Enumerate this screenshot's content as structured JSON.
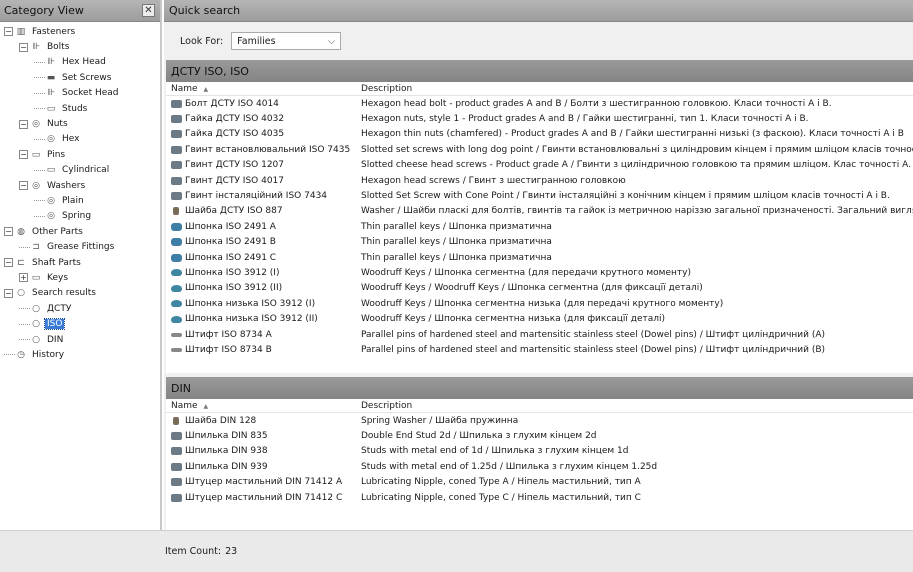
{
  "category_panel": {
    "title": "Category View",
    "close_glyph": "✕",
    "tree": [
      {
        "label": "Fasteners",
        "level": 0,
        "expander": "−",
        "icon": "folder-icon"
      },
      {
        "label": "Bolts",
        "level": 1,
        "expander": "−",
        "icon": "bolt-icon"
      },
      {
        "label": "Hex Head",
        "level": 2,
        "icon": "hex-head-icon"
      },
      {
        "label": "Set Screws",
        "level": 2,
        "icon": "set-screw-icon"
      },
      {
        "label": "Socket Head",
        "level": 2,
        "icon": "socket-head-icon"
      },
      {
        "label": "Studs",
        "level": 2,
        "icon": "stud-icon"
      },
      {
        "label": "Nuts",
        "level": 1,
        "expander": "−",
        "icon": "nut-icon"
      },
      {
        "label": "Hex",
        "level": 2,
        "icon": "hex-nut-icon"
      },
      {
        "label": "Pins",
        "level": 1,
        "expander": "−",
        "icon": "pin-icon"
      },
      {
        "label": "Cylindrical",
        "level": 2,
        "icon": "cylindrical-pin-icon"
      },
      {
        "label": "Washers",
        "level": 1,
        "expander": "−",
        "icon": "washer-icon"
      },
      {
        "label": "Plain",
        "level": 2,
        "icon": "plain-washer-icon"
      },
      {
        "label": "Spring",
        "level": 2,
        "icon": "spring-washer-icon"
      },
      {
        "label": "Other Parts",
        "level": 0,
        "expander": "−",
        "icon": "other-parts-icon"
      },
      {
        "label": "Grease Fittings",
        "level": 1,
        "icon": "grease-fitting-icon"
      },
      {
        "label": "Shaft Parts",
        "level": 0,
        "expander": "−",
        "icon": "shaft-icon"
      },
      {
        "label": "Keys",
        "level": 1,
        "expander": "+",
        "icon": "key-icon"
      },
      {
        "label": "Search results",
        "level": 0,
        "expander": "−",
        "icon": "search-icon"
      },
      {
        "label": "ДСТУ",
        "level": 1,
        "icon": "search-icon"
      },
      {
        "label": "ISO",
        "level": 1,
        "icon": "search-icon",
        "selected": true
      },
      {
        "label": "DIN",
        "level": 1,
        "icon": "search-icon"
      },
      {
        "label": "History",
        "level": 0,
        "icon": "history-icon"
      }
    ]
  },
  "quick_search": {
    "title": "Quick search",
    "look_for_label": "Look For:",
    "look_for_value": "Families",
    "dropdown_glyph": "⌵"
  },
  "sections": [
    {
      "title": "ДСТУ ISO, ISO",
      "col_name": "Name",
      "col_desc": "Description",
      "sort_glyph": "▲",
      "rows": [
        {
          "name": "Болт ДСТУ ISO 4014",
          "desc": "Hexagon head bolt - product grades A and B / Болти з шестигранною головкою. Класи точності А і В.",
          "icon": "bolt-icon"
        },
        {
          "name": "Гайка ДСТУ ISO 4032",
          "desc": "Hexagon nuts, style 1 - Product grades A and B / Гайки шестигранні, тип 1. Класи точності А і В.",
          "icon": "nut-icon"
        },
        {
          "name": "Гайка ДСТУ ISO 4035",
          "desc": "Hexagon thin nuts (chamfered) - Product grades A and B / Гайки шестигранні низькі (з фаскою). Класи точності А і В",
          "icon": "nut-icon"
        },
        {
          "name": "Гвинт встановлювальний ISO 7435",
          "desc": "Slotted set screws with long dog point / Гвинти встановлювальні з циліндровим кінцем і прямим шліцом класів точності А і.",
          "icon": "set-screw-icon"
        },
        {
          "name": "Гвинт ДСТУ ISO 1207",
          "desc": "Slotted cheese head screws - Product grade A / Ґвинти з циліндричною головкою та прямим шліцом. Клас точності А.",
          "icon": "screw-icon"
        },
        {
          "name": "Гвинт ДСТУ ISO 4017",
          "desc": "Hexagon head screws / Гвинт з  шестигранною головкою",
          "icon": "screw-icon"
        },
        {
          "name": "Гвинт інсталяційний ISO 7434",
          "desc": "Slotted Set Screw with Cone Point / Гвинти інсталяційні з конічним кінцем і прямим шліцом класів точності А і В.",
          "icon": "set-screw-icon"
        },
        {
          "name": "Шайба ДСТУ ISO 887",
          "desc": "Washer / Шайби пласкі для болтів, гвинтів та гайок із метричною наріззю загальної призначеності. Загальний вигляд",
          "icon": "washer-icon"
        },
        {
          "name": "Шпонка ISO 2491 A",
          "desc": "Thin parallel keys / Шпонка призматична",
          "icon": "key-icon"
        },
        {
          "name": "Шпонка ISO 2491 B",
          "desc": "Thin parallel keys / Шпонка призматична",
          "icon": "key-icon"
        },
        {
          "name": "Шпонка ISO 2491 C",
          "desc": "Thin parallel keys / Шпонка призматична",
          "icon": "key-icon"
        },
        {
          "name": "Шпонка ISO 3912 (I)",
          "desc": "Woodruff Keys / Шпонка сегментна (для передачи крутного моменту)",
          "icon": "woodruff-key-icon"
        },
        {
          "name": "Шпонка ISO 3912 (II)",
          "desc": "Woodruff Keys / Woodruff Keys / Шпонка сегментна (для фиксацїї деталі)",
          "icon": "woodruff-key-icon"
        },
        {
          "name": "Шпонка низька ISO 3912 (I)",
          "desc": "Woodruff Keys / Шпонка сегментна низька (для передачі крутного моменту)",
          "icon": "woodruff-key-icon"
        },
        {
          "name": "Шпонка низька ISO 3912 (II)",
          "desc": "Woodruff Keys / Шпонка сегментна низька (для фиксацїї деталі)",
          "icon": "woodruff-key-icon"
        },
        {
          "name": "Штифт ISO 8734 A",
          "desc": "Parallel pins of hardened steel and martensitic stainless steel (Dowel pins) / Штифт циліндричний (А)",
          "icon": "pin-icon"
        },
        {
          "name": "Штифт ISO 8734 B",
          "desc": "Parallel pins of hardened steel and martensitic stainless steel (Dowel pins) / Штифт циліндричний (В)",
          "icon": "pin-icon"
        }
      ]
    },
    {
      "title": "DIN",
      "col_name": "Name",
      "col_desc": "Description",
      "sort_glyph": "▲",
      "rows": [
        {
          "name": "Шайба DIN 128",
          "desc": "Spring Washer / Шайба пружинна",
          "icon": "washer-icon"
        },
        {
          "name": "Шпилька DIN 835",
          "desc": "Double End Stud 2d / Шпилька з глухим кінцем 2d",
          "icon": "stud-icon"
        },
        {
          "name": "Шпилька DIN 938",
          "desc": "Studs with metal end of 1d / Шпилька з глухим кінцем 1d",
          "icon": "stud-icon"
        },
        {
          "name": "Шпилька DIN 939",
          "desc": "Studs with metal end of 1.25d / Шпилька з глухим кінцем 1.25d",
          "icon": "stud-icon"
        },
        {
          "name": "Штуцер мастильний DIN 71412 A",
          "desc": "Lubricating Nipple, coned Type A / Ніпель мастильний, тип А",
          "icon": "grease-fitting-icon"
        },
        {
          "name": "Штуцер мастильний DIN 71412 C",
          "desc": "Lubricating Nipple, coned Type C / Ніпель мастильний, тип С",
          "icon": "grease-fitting-icon"
        }
      ]
    }
  ],
  "status": {
    "item_count_label": "Item Count:",
    "item_count": "23"
  }
}
